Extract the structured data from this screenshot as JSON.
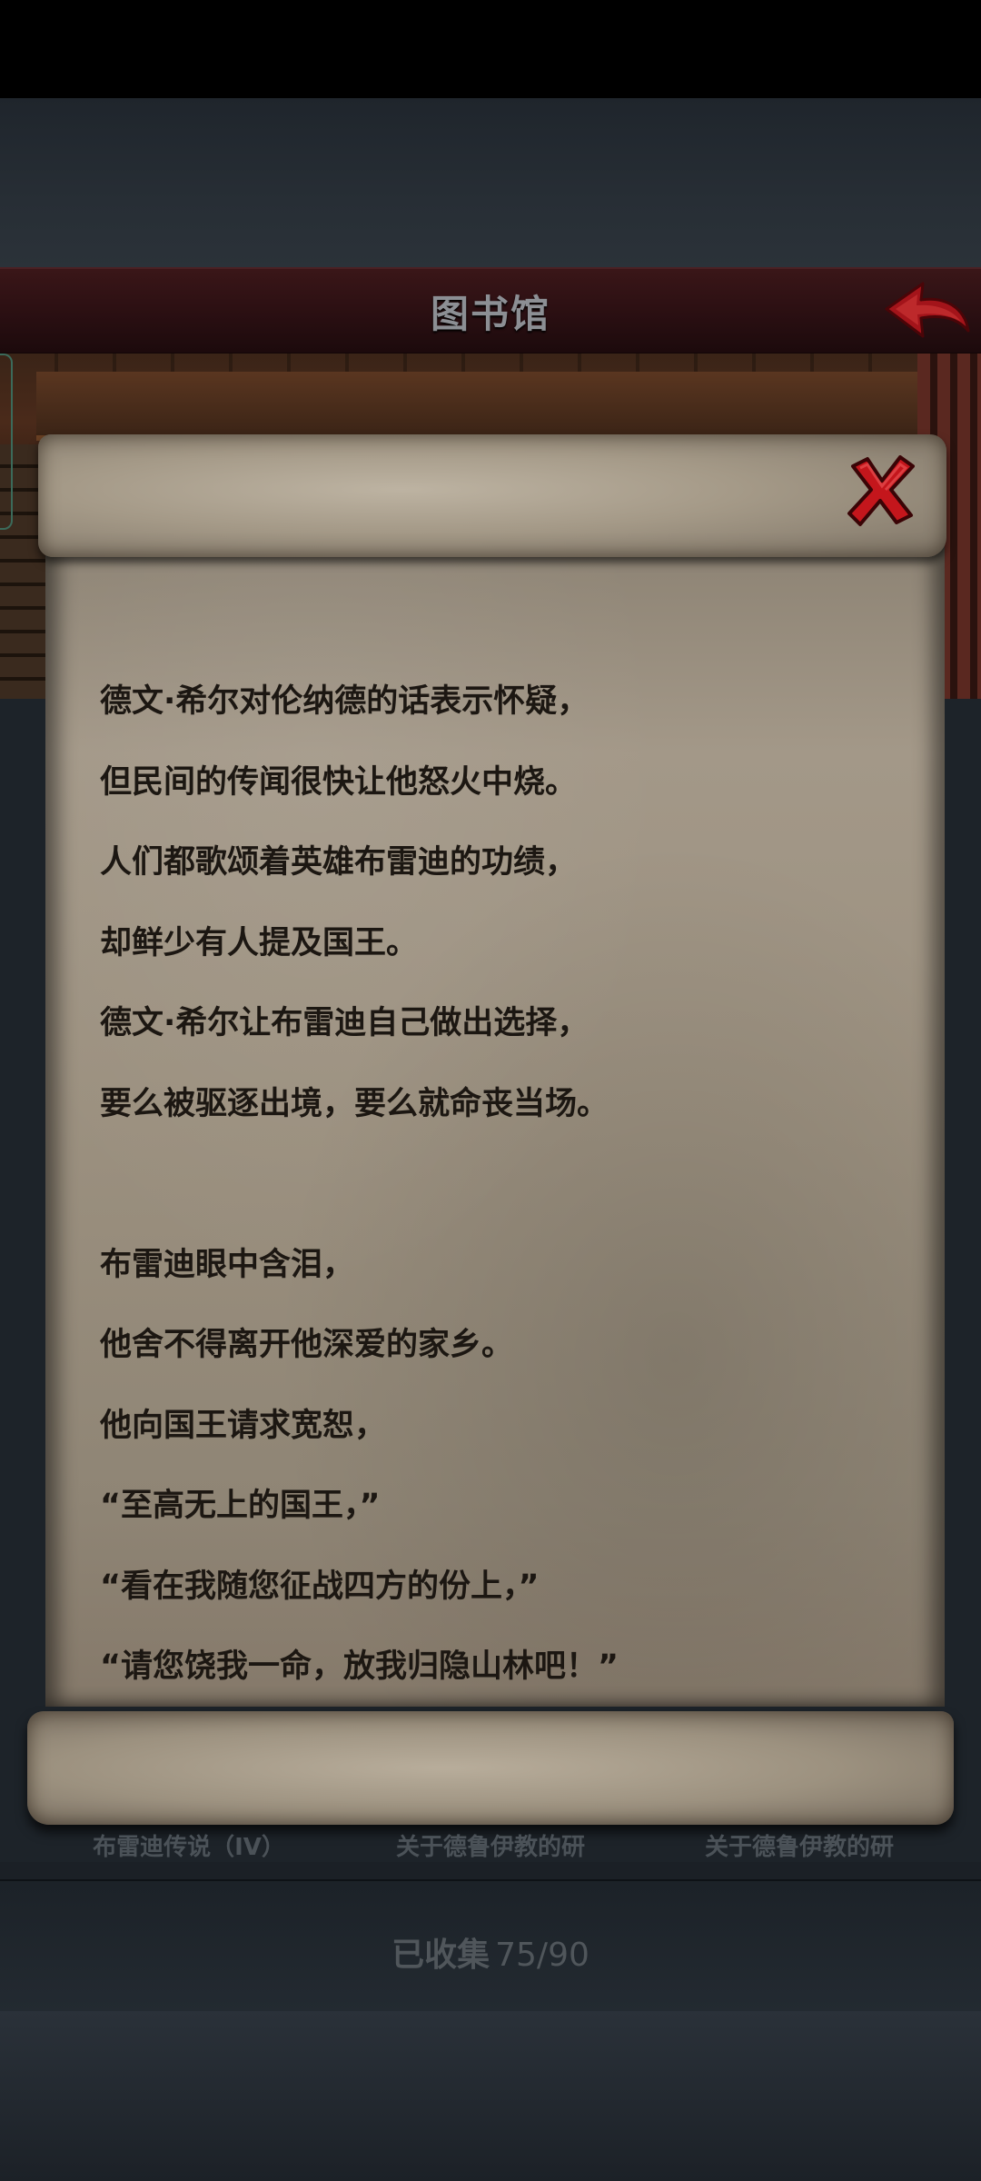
{
  "header": {
    "title": "图书馆",
    "back_icon": "back-arrow-icon"
  },
  "scroll": {
    "close_icon": "close-x-icon",
    "lines": [
      "德文·希尔对伦纳德的话表示怀疑，",
      "但民间的传闻很快让他怒火中烧。",
      "人们都歌颂着英雄布雷迪的功绩，",
      "却鲜少有人提及国王。",
      "德文·希尔让布雷迪自己做出选择，",
      "要么被驱逐出境，要么就命丧当场。",
      "",
      "布雷迪眼中含泪，",
      "他舍不得离开他深爱的家乡。",
      "他向国王请求宽恕，",
      "“至高无上的国王，”",
      "“看在我随您征战四方的份上，”",
      "“请您饶我一命，放我归隐山林吧！”"
    ]
  },
  "tabs": [
    {
      "label": "布雷迪传说（IV）"
    },
    {
      "label": "关于德鲁伊教的研"
    },
    {
      "label": "关于德鲁伊教的研"
    }
  ],
  "collection": {
    "label": "已收集",
    "count": "75/90"
  },
  "colors": {
    "close_red": "#c4161c",
    "back_red": "#b0141a",
    "text": "#1c1712"
  }
}
